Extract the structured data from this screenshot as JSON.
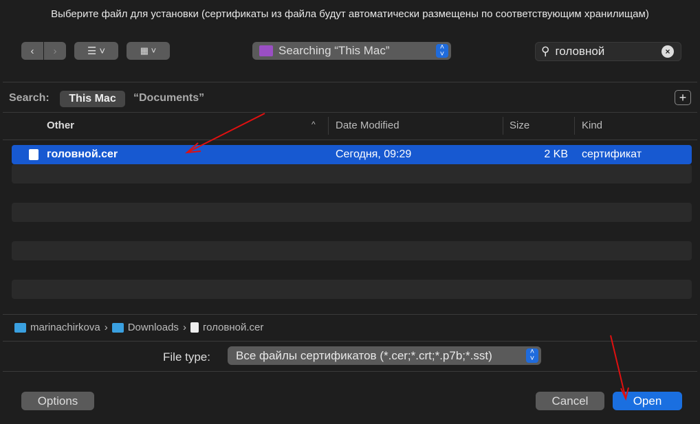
{
  "dialog": {
    "title": "Выберите файл для установки (сертификаты из файла будут автоматически размещены по соответствующим хранилищам)"
  },
  "toolbar": {
    "location": "Searching “This Mac”",
    "search_value": "головной"
  },
  "scope": {
    "label": "Search:",
    "options": [
      "This Mac",
      "“Documents”"
    ]
  },
  "columns": [
    "Other",
    "Date Modified",
    "Size",
    "Kind"
  ],
  "files": [
    {
      "name": "головной.cer",
      "date": "Сегодня, 09:29",
      "size": "2 KB",
      "kind": "сертификат",
      "selected": true
    }
  ],
  "path": [
    "marinachirkova",
    "Downloads",
    "головной.cer"
  ],
  "file_type": {
    "label": "File type:",
    "value": "Все файлы сертификатов (*.cer;*.crt;*.p7b;*.sst)"
  },
  "buttons": {
    "options": "Options",
    "cancel": "Cancel",
    "open": "Open"
  },
  "colors": {
    "accent": "#1759d1",
    "annotation": "#e01010"
  }
}
